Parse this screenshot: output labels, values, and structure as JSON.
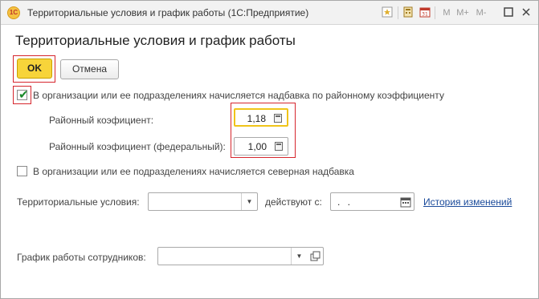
{
  "window": {
    "title": "Территориальные условия и график работы  (1С:Предприятие)",
    "app_icon": "1C",
    "toolbar": [
      "M",
      "M+",
      "M-"
    ]
  },
  "form": {
    "heading": "Территориальные условия и график работы",
    "ok_label": "OK",
    "cancel_label": "Отмена",
    "regional_coef_checkbox": {
      "label": "В организации или ее подразделениях начисляется надбавка по районному коэффициенту",
      "checked": true
    },
    "regional_coef": {
      "label": "Районный коэфициент:",
      "value": "1,18"
    },
    "regional_coef_federal": {
      "label": "Районный коэфициент (федеральный):",
      "value": "1,00"
    },
    "northern_checkbox": {
      "label": "В организации или ее подразделениях начисляется северная надбавка",
      "checked": false
    },
    "territorial": {
      "label": "Территориальные условия:",
      "value": "",
      "valid_from_label": "действуют с:",
      "valid_from_value": " .  ."
    },
    "history_link": "История изменений",
    "schedule": {
      "label": "График работы сотрудников:",
      "value": ""
    }
  },
  "colors": {
    "highlight": "#d6262d",
    "ok_button": "#f7d43a",
    "active_field": "#f0c419",
    "check": "#1b8a2a",
    "link": "#1a4a9a"
  }
}
